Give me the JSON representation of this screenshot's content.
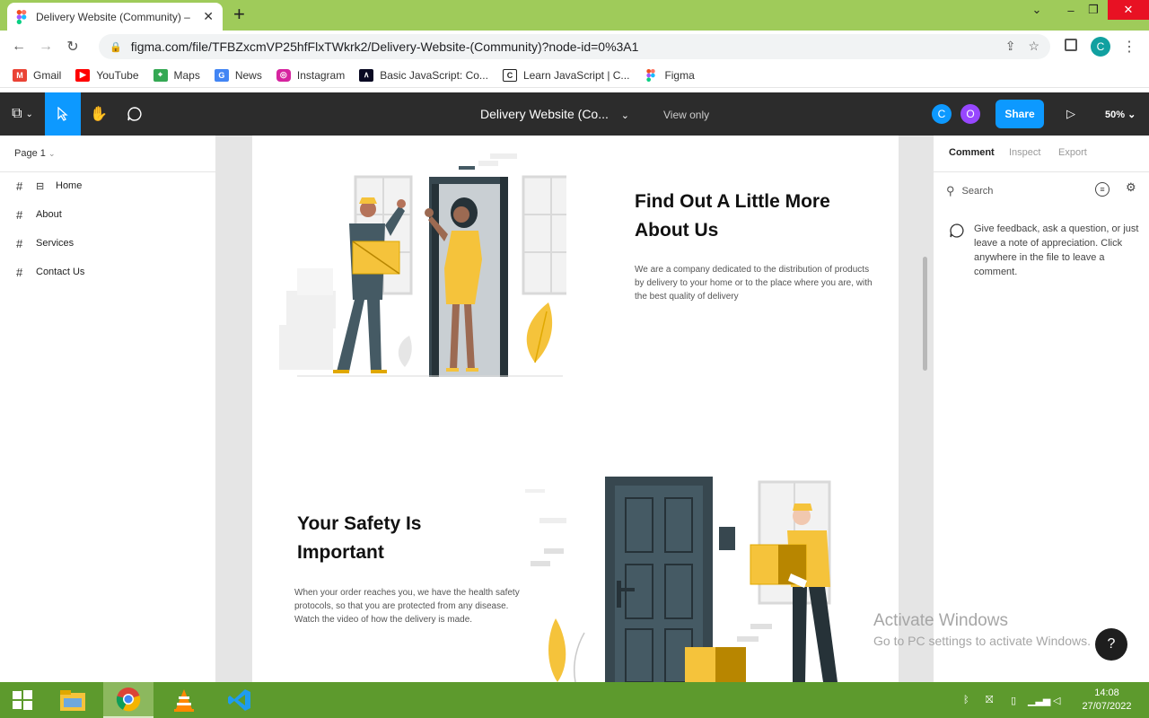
{
  "browser": {
    "tab_title": "Delivery Website (Community) –",
    "url": "figma.com/file/TFBZxcmVP25hfFlxTWkrk2/Delivery-Website-(Community)?node-id=0%3A1",
    "profile_initial": "C",
    "bookmarks": [
      {
        "label": "Gmail",
        "icon": "gmail-icon",
        "color": "#ea4335"
      },
      {
        "label": "YouTube",
        "icon": "youtube-icon",
        "color": "#ff0000"
      },
      {
        "label": "Maps",
        "icon": "maps-icon",
        "color": "#34a853"
      },
      {
        "label": "News",
        "icon": "news-icon",
        "color": "#4285f4"
      },
      {
        "label": "Instagram",
        "icon": "instagram-icon",
        "color": "#d6249f"
      },
      {
        "label": "Basic JavaScript: Co...",
        "icon": "freecodecamp-icon",
        "color": "#0a0a23"
      },
      {
        "label": "Learn JavaScript | C...",
        "icon": "codecademy-icon",
        "color": "#1f1f1f"
      },
      {
        "label": "Figma",
        "icon": "figma-icon",
        "color": "#f24e1e"
      }
    ]
  },
  "figma": {
    "doc_title": "Delivery Website (Co...",
    "view_mode": "View only",
    "share_label": "Share",
    "zoom": "50%",
    "collaborators": [
      {
        "initial": "C",
        "color": "#0d99ff"
      },
      {
        "initial": "O",
        "color": "#9747ff"
      }
    ],
    "page": "Page 1",
    "layers": [
      "Home",
      "About",
      "Services",
      "Contact Us"
    ],
    "right_tabs": [
      "Comment",
      "Inspect",
      "Export"
    ],
    "search_placeholder": "Search",
    "comment_hint": "Give feedback, ask a question, or just leave a note of appreciation. Click anywhere in the file to leave a comment."
  },
  "canvas": {
    "about": {
      "heading": "Find Out A Little More About Us",
      "body": "We are a company dedicated to the distribution of products by delivery to your home or to the place where you are, with the best quality of delivery"
    },
    "safety": {
      "heading": "Your Safety Is Important",
      "body": "When your order reaches you, we have the health safety protocols, so that you are protected from any disease. Watch the video of how the delivery is made."
    }
  },
  "windows": {
    "activate_title": "Activate Windows",
    "activate_sub": "Go to PC settings to activate Windows.",
    "time": "14:08",
    "date": "27/07/2022"
  },
  "colors": {
    "accent": "#0d99ff",
    "brand_yellow": "#f5c33b",
    "dark_slate": "#37474f",
    "taskbar": "#5d9a2d"
  }
}
